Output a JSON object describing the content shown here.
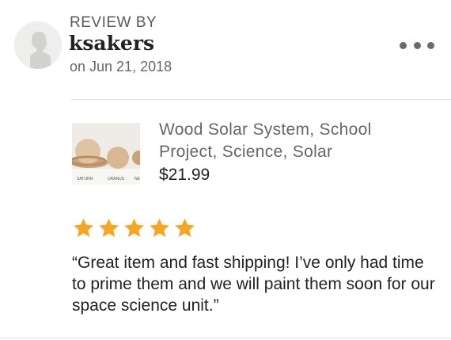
{
  "review": {
    "heading": "REVIEW BY",
    "username": "ksakers",
    "date": "on Jun 21, 2018",
    "more_icon": "more-horizontal-icon",
    "rating": 5,
    "rating_max": 5,
    "text": "“Great item and fast shipping! I’ve only had time to prime them and we will paint them soon for our space science unit.”"
  },
  "product": {
    "title": "Wood Solar System, School Project, Science, Solar",
    "price": "$21.99",
    "image_labels": [
      "SATURN",
      "URANUS",
      "NE"
    ]
  },
  "colors": {
    "star": "#F5A623",
    "text_primary": "#222222",
    "text_secondary": "#666666",
    "divider": "#E2E2E2"
  }
}
